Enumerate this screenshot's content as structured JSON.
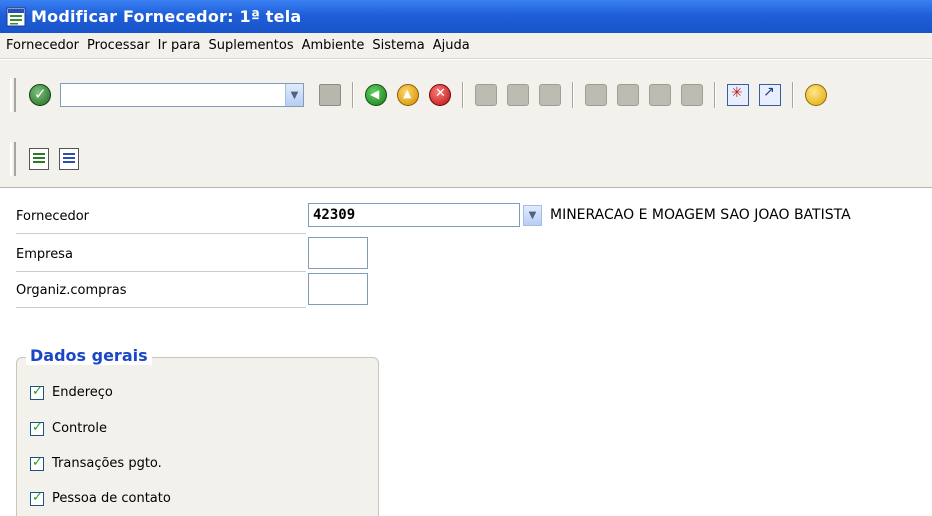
{
  "window": {
    "title": "Modificar Fornecedor: 1ª tela"
  },
  "menu": [
    "Fornecedor",
    "Processar",
    "Ir para",
    "Suplementos",
    "Ambiente",
    "Sistema",
    "Ajuda"
  ],
  "toolbar": {
    "command_field_value": "",
    "icons": [
      "check-icon",
      "save-icon",
      "back-icon",
      "exit-icon",
      "cancel-icon",
      "print-icon",
      "find-icon",
      "find-next-icon",
      "first-page-icon",
      "previous-page-icon",
      "next-page-icon",
      "last-page-icon",
      "create-session-icon",
      "shortcut-icon",
      "help-icon"
    ]
  },
  "app_toolbar": {
    "icons": [
      "list-green-icon",
      "list-blue-icon"
    ]
  },
  "form": {
    "vendor_label": "Fornecedor",
    "vendor_value": "42309",
    "vendor_name": "MINERACAO E MOAGEM SAO JOAO BATISTA",
    "company_label": "Empresa",
    "company_value": "",
    "purch_org_label": "Organiz.compras",
    "purch_org_value": ""
  },
  "general_data": {
    "title": "Dados gerais",
    "items": [
      {
        "label": "Endereço",
        "checked": true
      },
      {
        "label": "Controle",
        "checked": true
      },
      {
        "label": "Transações pgto.",
        "checked": true
      },
      {
        "label": "Pessoa de contato",
        "checked": true
      }
    ]
  }
}
